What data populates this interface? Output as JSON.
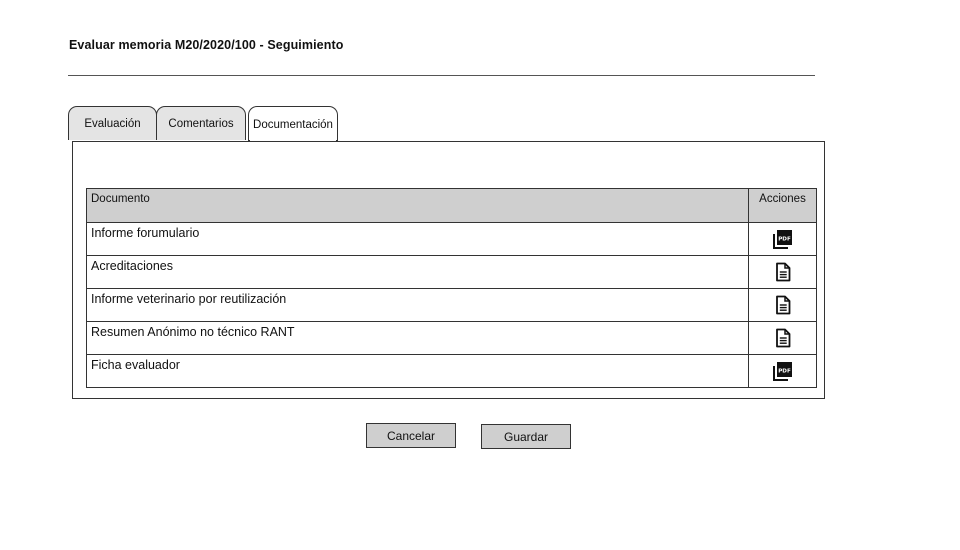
{
  "page": {
    "title": "Evaluar memoria M20/2020/100 - Seguimiento"
  },
  "tabs": [
    {
      "label": "Evaluación",
      "active": false
    },
    {
      "label": "Comentarios",
      "active": false
    },
    {
      "label": "Documentación",
      "active": true
    }
  ],
  "table": {
    "headers": {
      "document": "Documento",
      "actions": "Acciones"
    },
    "rows": [
      {
        "document": "Informe forumulario",
        "action_icon": "pdf-icon"
      },
      {
        "document": "Acreditaciones",
        "action_icon": "document-icon"
      },
      {
        "document": "Informe veterinario por reutilización",
        "action_icon": "document-icon"
      },
      {
        "document": "Resumen Anónimo no técnico RANT",
        "action_icon": "document-icon"
      },
      {
        "document": "Ficha evaluador",
        "action_icon": "pdf-icon"
      }
    ]
  },
  "buttons": {
    "cancel": "Cancelar",
    "save": "Guardar"
  },
  "colors": {
    "header_bg": "#cfcfcf",
    "inactive_tab_bg": "#e4e4e4",
    "button_bg": "#cfcfcf",
    "border": "#333333"
  }
}
